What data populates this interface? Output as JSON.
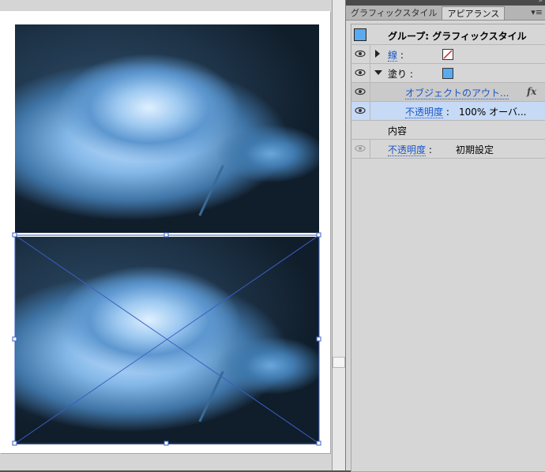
{
  "panel": {
    "tabs": [
      {
        "label": "グラフィックスタイル",
        "active": false
      },
      {
        "label": "アピアランス",
        "active": true
      }
    ],
    "menu_icon": "panel-menu-icon",
    "header": {
      "title": "グループ: グラフィックスタイル",
      "swatch_color": "#5aaaf0"
    },
    "rows": {
      "stroke": {
        "label": "線",
        "colon": ":",
        "swatch": "none"
      },
      "fill": {
        "label": "塗り",
        "colon": ":",
        "swatch_color": "#5aaaf0"
      },
      "effect": {
        "label": "オブジェクトのアウト...",
        "fx": "fx"
      },
      "fill_opacity": {
        "label": "不透明度",
        "colon": ":",
        "value": "100% オーバ..."
      },
      "contents": {
        "label": "内容"
      },
      "opacity": {
        "label": "不透明度",
        "colon": ":",
        "value": "初期設定"
      }
    }
  },
  "colors": {
    "accent": "#1a56c8",
    "selection_stroke": "#3a5fc4",
    "selected_row": "#c6d9f5"
  }
}
